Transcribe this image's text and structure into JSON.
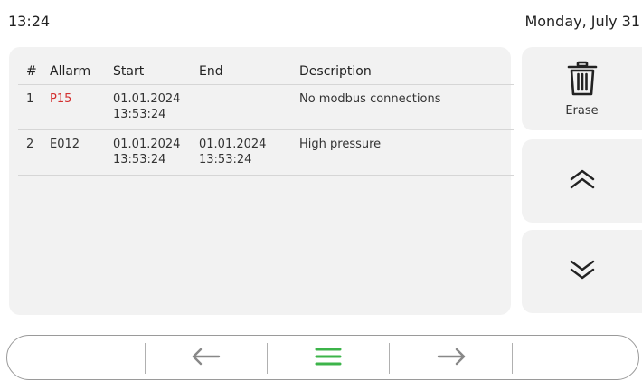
{
  "status": {
    "time": "13:24",
    "date": "Monday, July 31"
  },
  "table": {
    "headers": {
      "num": "#",
      "alarm": "Allarm",
      "start": "Start",
      "end": "End",
      "description": "Description"
    },
    "rows": [
      {
        "num": "1",
        "alarm": "P15",
        "start_date": "01.01.2024",
        "start_time": "13:53:24",
        "end_date": "",
        "end_time": "",
        "description": "No modbus connections",
        "alarm_color": "#d32f2f"
      },
      {
        "num": "2",
        "alarm": "E012",
        "start_date": "01.01.2024",
        "start_time": "13:53:24",
        "end_date": "01.01.2024",
        "end_time": "13:53:24",
        "description": "High pressure",
        "alarm_color": "#333333"
      }
    ]
  },
  "side": {
    "erase_label": "Erase",
    "erase_icon": "trash-icon",
    "up_icon": "chevron-double-up-icon",
    "down_icon": "chevron-double-down-icon"
  },
  "nav": {
    "back_icon": "arrow-left-icon",
    "menu_icon": "menu-icon",
    "forward_icon": "arrow-right-icon",
    "menu_color": "#3cb44a"
  }
}
